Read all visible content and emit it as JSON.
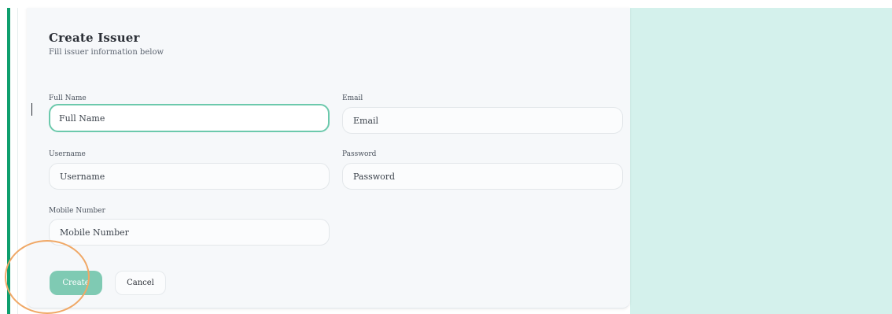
{
  "form": {
    "title": "Create Issuer",
    "subtitle": "Fill issuer information below",
    "fields": [
      {
        "label": "Full Name",
        "placeholder": "Full Name",
        "focused": true
      },
      {
        "label": "Email",
        "placeholder": "Email"
      },
      {
        "label": "Username",
        "placeholder": "Username"
      },
      {
        "label": "Password",
        "placeholder": "Password"
      },
      {
        "label": "Mobile Number",
        "placeholder": "Mobile Number"
      }
    ],
    "create_label": "Create",
    "cancel_label": "Cancel"
  },
  "colors": {
    "accent": "#0e9f6e",
    "focus_border": "#6cc9ac",
    "create_button": "#7fcab3",
    "right_panel": "#d4f1ec",
    "click_highlight": "#f0a866"
  }
}
